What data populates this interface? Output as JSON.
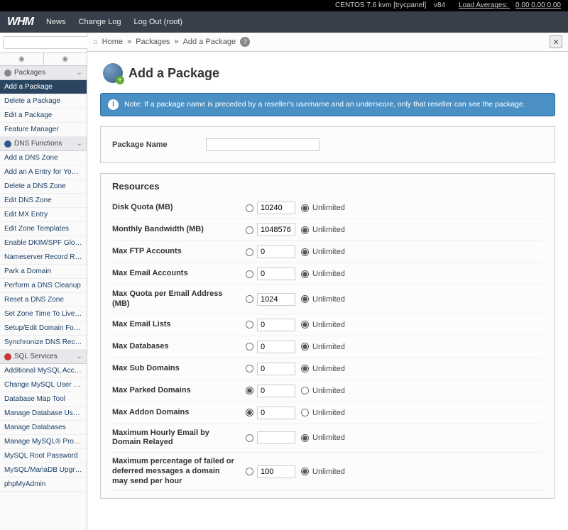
{
  "topstrip": {
    "os": "CENTOS 7.6 kvm [trycpanel]",
    "ver": "v84",
    "load_label": "Load Averages:",
    "load": "0.00 0.00 0.00"
  },
  "logo": "WHM",
  "nav": {
    "news": "News",
    "changelog": "Change Log",
    "logout": "Log Out (root)"
  },
  "breadcrumb": {
    "home": "Home",
    "sep": "»",
    "pkg": "Packages",
    "page": "Add a Package"
  },
  "title": "Add a Package",
  "info": "Note: If a package name is preceded by a reseller's username and an underscore, only that reseller can see the package.",
  "pkgname_label": "Package Name",
  "resources_title": "Resources",
  "unlimited": "Unlimited",
  "sidebar": {
    "cats": [
      {
        "label": "Packages",
        "icon": "plain"
      },
      {
        "label": "DNS Functions",
        "icon": "blue"
      },
      {
        "label": "SQL Services",
        "icon": "red"
      }
    ],
    "pkg": [
      "Add a Package",
      "Delete a Package",
      "Edit a Package",
      "Feature Manager"
    ],
    "dns": [
      "Add a DNS Zone",
      "Add an A Entry for Your Hostname",
      "Delete a DNS Zone",
      "Edit DNS Zone",
      "Edit MX Entry",
      "Edit Zone Templates",
      "Enable DKIM/SPF Globally",
      "Nameserver Record Report",
      "Park a Domain",
      "Perform a DNS Cleanup",
      "Reset a DNS Zone",
      "Set Zone Time To Live (TTL)",
      "Setup/Edit Domain Forwarding",
      "Synchronize DNS Records"
    ],
    "sql": [
      "Additional MySQL Access Hosts",
      "Change MySQL User Password",
      "Database Map Tool",
      "Manage Database Users",
      "Manage Databases",
      "Manage MySQL® Profiles",
      "MySQL Root Password",
      "MySQL/MariaDB Upgrade",
      "phpMyAdmin"
    ]
  },
  "resources": [
    {
      "label": "Disk Quota (MB)",
      "value": "10240",
      "sel": "unl"
    },
    {
      "label": "Monthly Bandwidth (MB)",
      "value": "1048576",
      "sel": "unl"
    },
    {
      "label": "Max FTP Accounts",
      "value": "0",
      "sel": "unl"
    },
    {
      "label": "Max Email Accounts",
      "value": "0",
      "sel": "unl"
    },
    {
      "label": "Max Quota per Email Address (MB)",
      "value": "1024",
      "sel": "unl"
    },
    {
      "label": "Max Email Lists",
      "value": "0",
      "sel": "unl"
    },
    {
      "label": "Max Databases",
      "value": "0",
      "sel": "unl"
    },
    {
      "label": "Max Sub Domains",
      "value": "0",
      "sel": "unl"
    },
    {
      "label": "Max Parked Domains",
      "value": "0",
      "sel": "val"
    },
    {
      "label": "Max Addon Domains",
      "value": "0",
      "sel": "val"
    },
    {
      "label": "Maximum Hourly Email by Domain Relayed",
      "value": "",
      "sel": "unl"
    },
    {
      "label": "Maximum percentage of failed or deferred messages a domain may send per hour",
      "value": "100",
      "sel": "unl"
    }
  ]
}
